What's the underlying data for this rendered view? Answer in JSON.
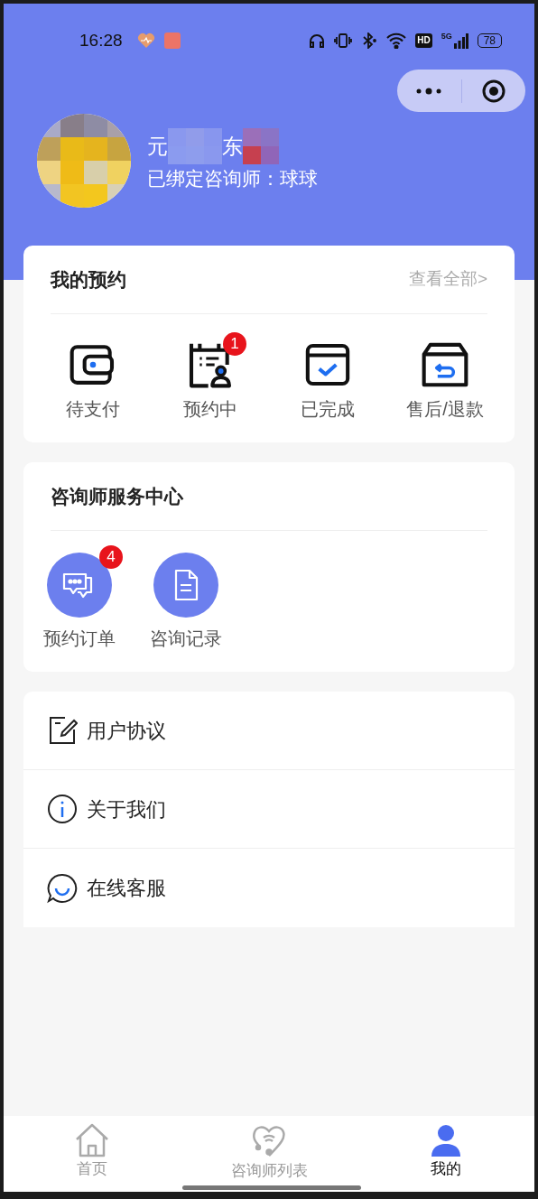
{
  "status_bar": {
    "time": "16:28",
    "network": "5G",
    "battery": "78",
    "hd": "HD"
  },
  "profile": {
    "name_parts": [
      "元",
      "东"
    ],
    "bound_counselor": "已绑定咨询师：球球"
  },
  "appointments": {
    "title": "我的预约",
    "view_all": "查看全部>",
    "items": [
      {
        "kind": "wallet",
        "label": "待支付"
      },
      {
        "kind": "booking",
        "label": "预约中",
        "badge": "1"
      },
      {
        "kind": "done",
        "label": "已完成"
      },
      {
        "kind": "refund",
        "label": "售后/退款"
      }
    ]
  },
  "service_center": {
    "title": "咨询师服务中心",
    "items": [
      {
        "kind": "chat",
        "label": "预约订单",
        "badge": "4"
      },
      {
        "kind": "doc",
        "label": "咨询记录"
      }
    ]
  },
  "menu": [
    {
      "kind": "agreement",
      "label": "用户协议"
    },
    {
      "kind": "about",
      "label": "关于我们"
    },
    {
      "kind": "service",
      "label": "在线客服"
    }
  ],
  "tab_bar": [
    {
      "kind": "home",
      "label": "首页",
      "selected": false
    },
    {
      "kind": "list",
      "label": "咨询师列表",
      "selected": false
    },
    {
      "kind": "me",
      "label": "我的",
      "selected": true
    }
  ]
}
